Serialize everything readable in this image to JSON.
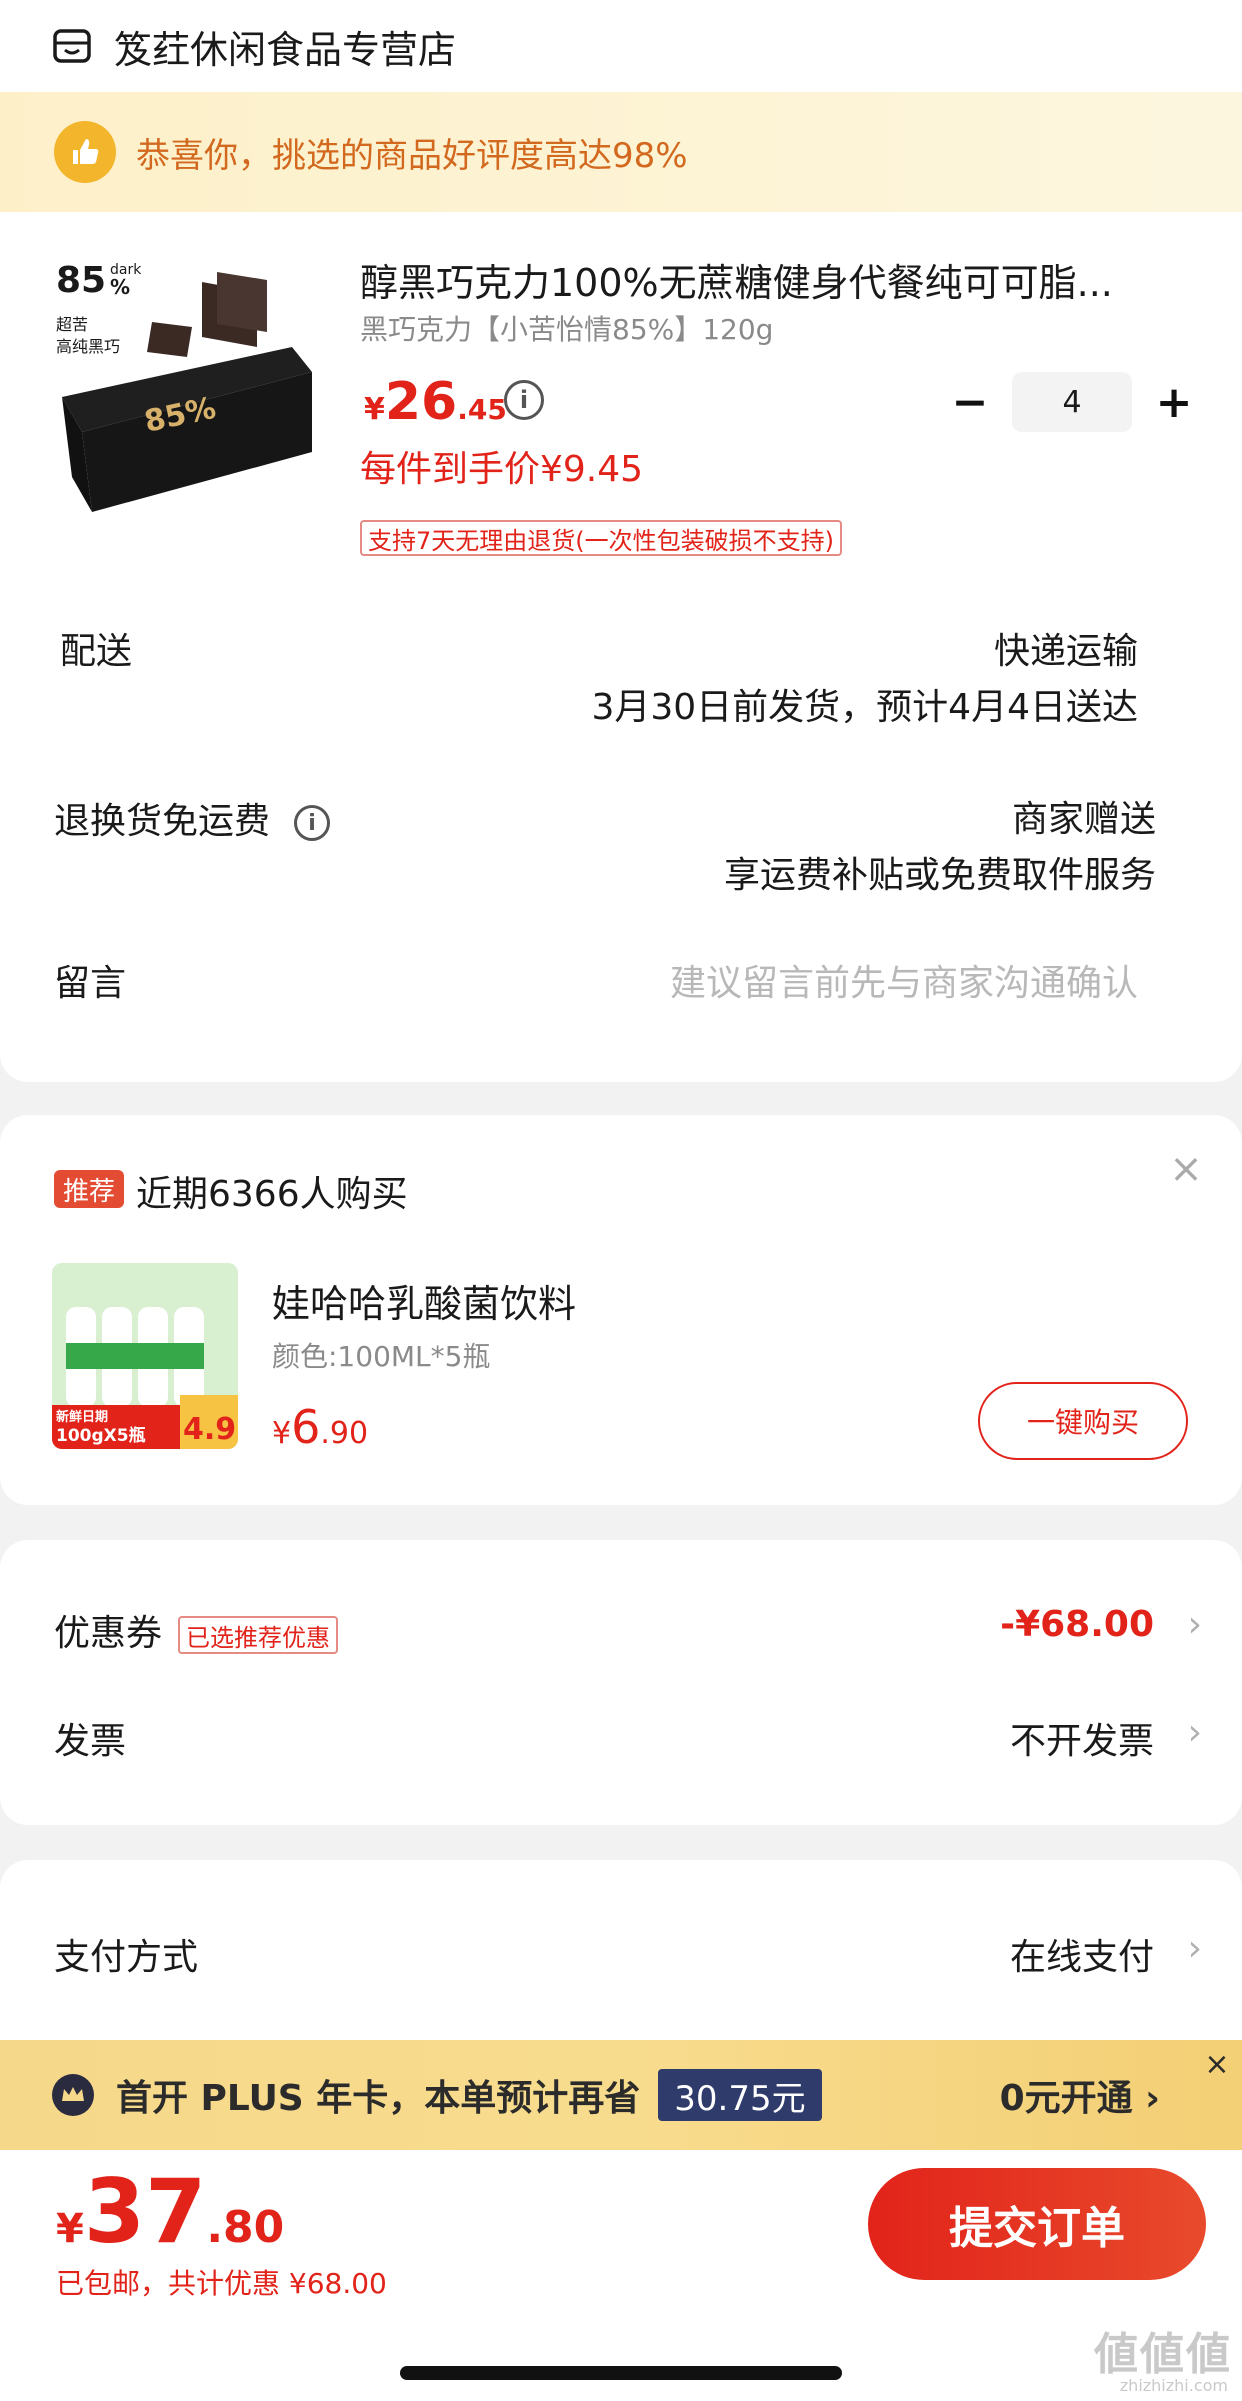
{
  "store": {
    "name": "笈荭休闲食品专营店"
  },
  "praise": {
    "text": "恭喜你，挑选的商品好评度高达98%"
  },
  "product": {
    "title": "醇黑巧克力100%无蔗糖健身代餐纯可可脂...",
    "spec": "黑巧克力【小苦怡情85%】120g",
    "price_symbol": "¥",
    "price_int": "26",
    "price_dec": ".45",
    "unit_price": "每件到手价¥9.45",
    "quantity": "4",
    "minus": "−",
    "plus": "+",
    "return_policy": "支持7天无理由退货(一次性包装破损不支持)",
    "image_text": {
      "percent": "85",
      "dark": "dark",
      "line1": "超苦",
      "line2": "高纯黑巧",
      "box_percent": "85%"
    }
  },
  "delivery": {
    "label": "配送",
    "method": "快递运输",
    "eta": "3月30日前发货，预计4月4日送达"
  },
  "return_shipping": {
    "label": "退换货免运费",
    "value1": "商家赠送",
    "value2": "享运费补贴或免费取件服务"
  },
  "message": {
    "label": "留言",
    "placeholder": "建议留言前先与商家沟通确认"
  },
  "recommend": {
    "badge": "推荐",
    "title": "近期6366人购买",
    "close": "×",
    "name": "娃哈哈乳酸菌饮料",
    "spec": "颜色:100ML*5瓶",
    "price_symbol": "¥",
    "price_int": "6",
    "price_dec": ".90",
    "buy_label": "一键购买",
    "image_text": {
      "tag": "新鲜日期",
      "size": "100gX5瓶",
      "price": "4.9"
    }
  },
  "coupon": {
    "label": "优惠券",
    "tag": "已选推荐优惠",
    "value": "-¥68.00",
    "chevron": "›"
  },
  "invoice": {
    "label": "发票",
    "value": "不开发票",
    "chevron": "›"
  },
  "payment": {
    "label": "支付方式",
    "value": "在线支付",
    "chevron": "›"
  },
  "plus_banner": {
    "text": "首开 PLUS 年卡，本单预计再省",
    "save": "30.75元",
    "open": "0元开通 ›",
    "close": "×"
  },
  "bottom": {
    "symbol": "¥",
    "int": "37",
    "dec": ".80",
    "note": "已包邮，共计优惠 ¥68.00",
    "submit": "提交订单"
  },
  "watermark": {
    "text": "値値値",
    "sub": "zhizhizhi.com"
  }
}
